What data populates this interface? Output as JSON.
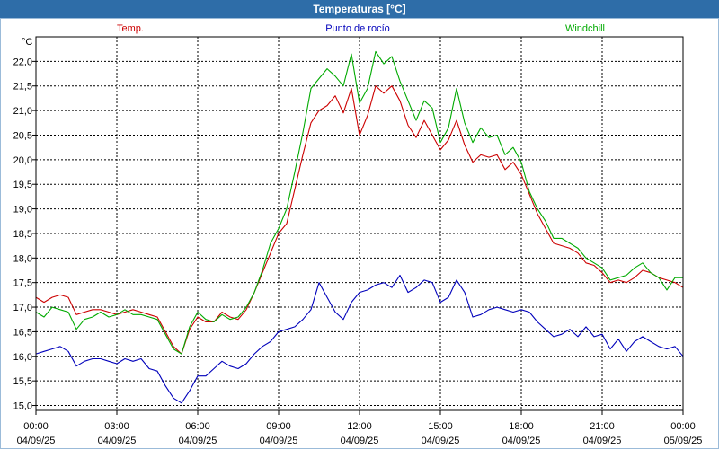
{
  "window": {
    "title": "Temperaturas [°C]"
  },
  "chart_data": {
    "type": "line",
    "unit_label": "°C",
    "ylim": [
      14.9,
      22.5
    ],
    "yticks": [
      "15,0",
      "15,5",
      "16,0",
      "16,5",
      "17,0",
      "17,5",
      "18,0",
      "18,5",
      "19,0",
      "19,5",
      "20,0",
      "20,5",
      "21,0",
      "21,5",
      "22,0"
    ],
    "xlim_hours": [
      0,
      24
    ],
    "xticks": [
      {
        "time": "00:00",
        "date": "04/09/25"
      },
      {
        "time": "03:00",
        "date": "04/09/25"
      },
      {
        "time": "06:00",
        "date": "04/09/25"
      },
      {
        "time": "09:00",
        "date": "04/09/25"
      },
      {
        "time": "12:00",
        "date": "04/09/25"
      },
      {
        "time": "15:00",
        "date": "04/09/25"
      },
      {
        "time": "18:00",
        "date": "04/09/25"
      },
      {
        "time": "21:00",
        "date": "04/09/25"
      },
      {
        "time": "00:00",
        "date": "05/09/25"
      }
    ],
    "grid": true,
    "series": [
      {
        "name": "Temp.",
        "color": "#cc0000",
        "points": [
          [
            0,
            17.2
          ],
          [
            0.3,
            17.1
          ],
          [
            0.6,
            17.2
          ],
          [
            0.9,
            17.25
          ],
          [
            1.2,
            17.2
          ],
          [
            1.5,
            16.85
          ],
          [
            1.8,
            16.9
          ],
          [
            2.1,
            16.95
          ],
          [
            2.4,
            16.95
          ],
          [
            2.7,
            16.9
          ],
          [
            3.0,
            16.85
          ],
          [
            3.3,
            16.9
          ],
          [
            3.6,
            16.95
          ],
          [
            3.9,
            16.9
          ],
          [
            4.2,
            16.85
          ],
          [
            4.5,
            16.8
          ],
          [
            4.8,
            16.5
          ],
          [
            5.1,
            16.2
          ],
          [
            5.4,
            16.05
          ],
          [
            5.7,
            16.55
          ],
          [
            6.0,
            16.8
          ],
          [
            6.3,
            16.7
          ],
          [
            6.6,
            16.7
          ],
          [
            6.9,
            16.9
          ],
          [
            7.2,
            16.8
          ],
          [
            7.5,
            16.75
          ],
          [
            7.8,
            16.95
          ],
          [
            8.1,
            17.3
          ],
          [
            8.4,
            17.7
          ],
          [
            8.7,
            18.1
          ],
          [
            9.0,
            18.5
          ],
          [
            9.3,
            18.7
          ],
          [
            9.6,
            19.4
          ],
          [
            9.9,
            20.1
          ],
          [
            10.2,
            20.75
          ],
          [
            10.5,
            21.0
          ],
          [
            10.8,
            21.1
          ],
          [
            11.1,
            21.3
          ],
          [
            11.4,
            20.95
          ],
          [
            11.7,
            21.45
          ],
          [
            12.0,
            20.5
          ],
          [
            12.3,
            20.9
          ],
          [
            12.6,
            21.5
          ],
          [
            12.9,
            21.35
          ],
          [
            13.2,
            21.5
          ],
          [
            13.5,
            21.2
          ],
          [
            13.8,
            20.7
          ],
          [
            14.1,
            20.45
          ],
          [
            14.4,
            20.8
          ],
          [
            14.7,
            20.5
          ],
          [
            15.0,
            20.2
          ],
          [
            15.3,
            20.4
          ],
          [
            15.6,
            20.8
          ],
          [
            15.9,
            20.3
          ],
          [
            16.2,
            19.95
          ],
          [
            16.5,
            20.1
          ],
          [
            16.8,
            20.05
          ],
          [
            17.1,
            20.1
          ],
          [
            17.4,
            19.8
          ],
          [
            17.7,
            19.95
          ],
          [
            18.0,
            19.7
          ],
          [
            18.3,
            19.3
          ],
          [
            18.6,
            18.9
          ],
          [
            18.9,
            18.6
          ],
          [
            19.2,
            18.3
          ],
          [
            19.5,
            18.25
          ],
          [
            19.8,
            18.2
          ],
          [
            20.1,
            18.1
          ],
          [
            20.4,
            17.9
          ],
          [
            20.7,
            17.85
          ],
          [
            21.0,
            17.7
          ],
          [
            21.3,
            17.5
          ],
          [
            21.6,
            17.55
          ],
          [
            21.9,
            17.5
          ],
          [
            22.2,
            17.6
          ],
          [
            22.5,
            17.75
          ],
          [
            22.8,
            17.7
          ],
          [
            23.1,
            17.6
          ],
          [
            23.4,
            17.55
          ],
          [
            23.7,
            17.5
          ],
          [
            24.0,
            17.4
          ]
        ]
      },
      {
        "name": "Punto de rocío",
        "color": "#0000bb",
        "points": [
          [
            0,
            16.05
          ],
          [
            0.3,
            16.1
          ],
          [
            0.6,
            16.15
          ],
          [
            0.9,
            16.2
          ],
          [
            1.2,
            16.1
          ],
          [
            1.5,
            15.8
          ],
          [
            1.8,
            15.9
          ],
          [
            2.1,
            15.95
          ],
          [
            2.4,
            15.95
          ],
          [
            2.7,
            15.9
          ],
          [
            3.0,
            15.85
          ],
          [
            3.3,
            15.95
          ],
          [
            3.6,
            15.9
          ],
          [
            3.9,
            15.95
          ],
          [
            4.2,
            15.75
          ],
          [
            4.5,
            15.7
          ],
          [
            4.8,
            15.4
          ],
          [
            5.1,
            15.15
          ],
          [
            5.4,
            15.05
          ],
          [
            5.7,
            15.3
          ],
          [
            6.0,
            15.6
          ],
          [
            6.3,
            15.6
          ],
          [
            6.6,
            15.75
          ],
          [
            6.9,
            15.9
          ],
          [
            7.2,
            15.8
          ],
          [
            7.5,
            15.75
          ],
          [
            7.8,
            15.85
          ],
          [
            8.1,
            16.05
          ],
          [
            8.4,
            16.2
          ],
          [
            8.7,
            16.3
          ],
          [
            9.0,
            16.5
          ],
          [
            9.3,
            16.55
          ],
          [
            9.6,
            16.6
          ],
          [
            9.9,
            16.75
          ],
          [
            10.2,
            16.95
          ],
          [
            10.5,
            17.5
          ],
          [
            10.8,
            17.2
          ],
          [
            11.1,
            16.9
          ],
          [
            11.4,
            16.75
          ],
          [
            11.7,
            17.1
          ],
          [
            12.0,
            17.3
          ],
          [
            12.3,
            17.35
          ],
          [
            12.6,
            17.45
          ],
          [
            12.9,
            17.5
          ],
          [
            13.2,
            17.4
          ],
          [
            13.5,
            17.65
          ],
          [
            13.8,
            17.3
          ],
          [
            14.1,
            17.4
          ],
          [
            14.4,
            17.55
          ],
          [
            14.7,
            17.5
          ],
          [
            15.0,
            17.1
          ],
          [
            15.3,
            17.2
          ],
          [
            15.6,
            17.55
          ],
          [
            15.9,
            17.3
          ],
          [
            16.2,
            16.8
          ],
          [
            16.5,
            16.85
          ],
          [
            16.8,
            16.95
          ],
          [
            17.1,
            17.0
          ],
          [
            17.4,
            16.95
          ],
          [
            17.7,
            16.9
          ],
          [
            18.0,
            16.95
          ],
          [
            18.3,
            16.9
          ],
          [
            18.6,
            16.7
          ],
          [
            18.9,
            16.55
          ],
          [
            19.2,
            16.4
          ],
          [
            19.5,
            16.45
          ],
          [
            19.8,
            16.55
          ],
          [
            20.1,
            16.4
          ],
          [
            20.4,
            16.6
          ],
          [
            20.7,
            16.4
          ],
          [
            21.0,
            16.45
          ],
          [
            21.3,
            16.15
          ],
          [
            21.6,
            16.35
          ],
          [
            21.9,
            16.1
          ],
          [
            22.2,
            16.3
          ],
          [
            22.5,
            16.4
          ],
          [
            22.8,
            16.3
          ],
          [
            23.1,
            16.2
          ],
          [
            23.4,
            16.15
          ],
          [
            23.7,
            16.2
          ],
          [
            24.0,
            16.0
          ]
        ]
      },
      {
        "name": "Windchill",
        "color": "#00aa00",
        "points": [
          [
            0,
            16.9
          ],
          [
            0.3,
            16.8
          ],
          [
            0.6,
            17.0
          ],
          [
            0.9,
            16.95
          ],
          [
            1.2,
            16.9
          ],
          [
            1.5,
            16.55
          ],
          [
            1.8,
            16.75
          ],
          [
            2.1,
            16.8
          ],
          [
            2.4,
            16.9
          ],
          [
            2.7,
            16.8
          ],
          [
            3.0,
            16.85
          ],
          [
            3.3,
            16.95
          ],
          [
            3.6,
            16.85
          ],
          [
            3.9,
            16.85
          ],
          [
            4.2,
            16.8
          ],
          [
            4.5,
            16.75
          ],
          [
            4.8,
            16.45
          ],
          [
            5.1,
            16.15
          ],
          [
            5.4,
            16.05
          ],
          [
            5.7,
            16.6
          ],
          [
            6.0,
            16.9
          ],
          [
            6.3,
            16.75
          ],
          [
            6.6,
            16.7
          ],
          [
            6.9,
            16.85
          ],
          [
            7.2,
            16.75
          ],
          [
            7.5,
            16.8
          ],
          [
            7.8,
            17.0
          ],
          [
            8.1,
            17.3
          ],
          [
            8.4,
            17.75
          ],
          [
            8.7,
            18.3
          ],
          [
            9.0,
            18.6
          ],
          [
            9.3,
            19.0
          ],
          [
            9.6,
            19.75
          ],
          [
            9.9,
            20.55
          ],
          [
            10.2,
            21.45
          ],
          [
            10.5,
            21.65
          ],
          [
            10.8,
            21.85
          ],
          [
            11.1,
            21.7
          ],
          [
            11.4,
            21.5
          ],
          [
            11.7,
            22.15
          ],
          [
            12.0,
            21.15
          ],
          [
            12.3,
            21.45
          ],
          [
            12.6,
            22.2
          ],
          [
            12.9,
            21.95
          ],
          [
            13.2,
            22.1
          ],
          [
            13.5,
            21.6
          ],
          [
            13.8,
            21.2
          ],
          [
            14.1,
            20.8
          ],
          [
            14.4,
            21.2
          ],
          [
            14.7,
            21.05
          ],
          [
            15.0,
            20.35
          ],
          [
            15.3,
            20.65
          ],
          [
            15.6,
            21.45
          ],
          [
            15.9,
            20.75
          ],
          [
            16.2,
            20.35
          ],
          [
            16.5,
            20.65
          ],
          [
            16.8,
            20.45
          ],
          [
            17.1,
            20.5
          ],
          [
            17.4,
            20.1
          ],
          [
            17.7,
            20.25
          ],
          [
            18.0,
            19.95
          ],
          [
            18.3,
            19.35
          ],
          [
            18.6,
            19.0
          ],
          [
            18.9,
            18.75
          ],
          [
            19.2,
            18.4
          ],
          [
            19.5,
            18.4
          ],
          [
            19.8,
            18.3
          ],
          [
            20.1,
            18.2
          ],
          [
            20.4,
            18.0
          ],
          [
            20.7,
            17.9
          ],
          [
            21.0,
            17.8
          ],
          [
            21.3,
            17.55
          ],
          [
            21.6,
            17.6
          ],
          [
            21.9,
            17.65
          ],
          [
            22.2,
            17.8
          ],
          [
            22.5,
            17.9
          ],
          [
            22.8,
            17.7
          ],
          [
            23.1,
            17.6
          ],
          [
            23.4,
            17.35
          ],
          [
            23.7,
            17.6
          ],
          [
            24.0,
            17.6
          ]
        ]
      }
    ]
  }
}
